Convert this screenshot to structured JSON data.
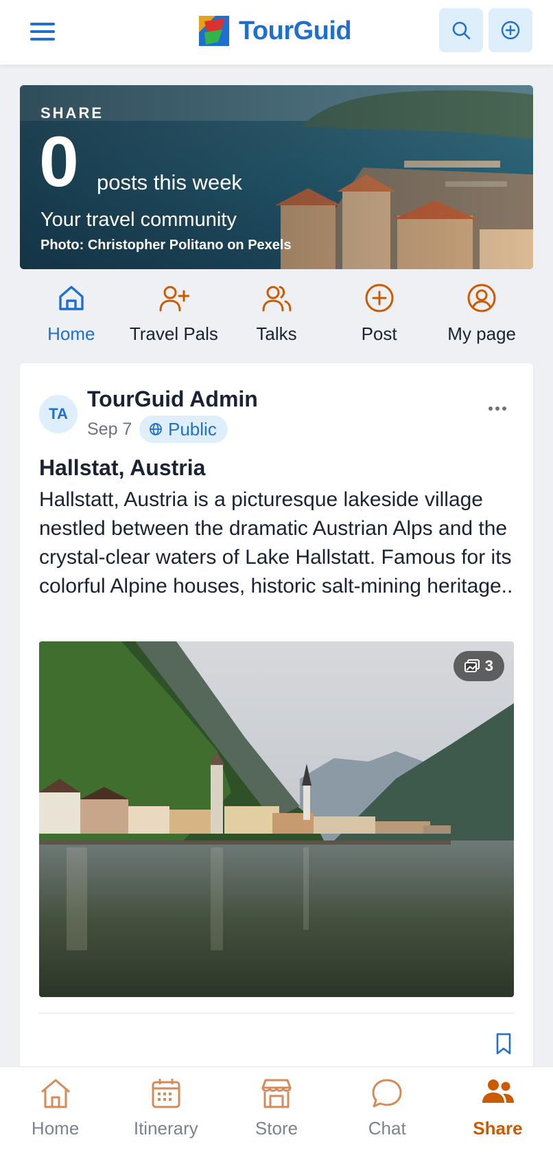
{
  "header": {
    "brand_name": "TourGuid",
    "menu_icon": "hamburger-menu-icon",
    "search_icon": "search-icon",
    "add_icon": "plus-circle-icon",
    "accent_color": "#1f6fd1"
  },
  "hero": {
    "eyebrow": "SHARE",
    "count": "0",
    "count_label": "posts this week",
    "subtitle": "Your travel community",
    "credit": "Photo: Christopher Politano on Pexels"
  },
  "share_nav": {
    "items": [
      {
        "label": "Home",
        "icon": "home-icon",
        "active": true
      },
      {
        "label": "Travel Pals",
        "icon": "add-user-icon",
        "active": false
      },
      {
        "label": "Talks",
        "icon": "users-icon",
        "active": false
      },
      {
        "label": "Post",
        "icon": "plus-circle-icon",
        "active": false
      },
      {
        "label": "My page",
        "icon": "user-circle-icon",
        "active": false
      }
    ],
    "active_color": "#1f6fd1",
    "icon_color": "#cc5a00"
  },
  "post": {
    "avatar_initials": "TA",
    "author": "TourGuid Admin",
    "date": "Sep 7",
    "visibility": "Public",
    "title": "Hallstat, Austria",
    "body": "Hallstatt, Austria is a picturesque lakeside village nestled between the dramatic Austrian Alps and the crystal-clear waters of Lake Hallstatt. Famous for its colorful Alpine houses, historic salt-mining heritage..",
    "photo_count": "3",
    "more_icon": "more-horizontal-icon",
    "bookmark_icon": "bookmark-icon"
  },
  "bottom_nav": {
    "items": [
      {
        "label": "Home",
        "icon": "home-icon",
        "active": false
      },
      {
        "label": "Itinerary",
        "icon": "calendar-icon",
        "active": false
      },
      {
        "label": "Store",
        "icon": "store-icon",
        "active": false
      },
      {
        "label": "Chat",
        "icon": "chat-bubble-icon",
        "active": false
      },
      {
        "label": "Share",
        "icon": "users-filled-icon",
        "active": true
      }
    ],
    "active_color": "#cc5a00"
  }
}
